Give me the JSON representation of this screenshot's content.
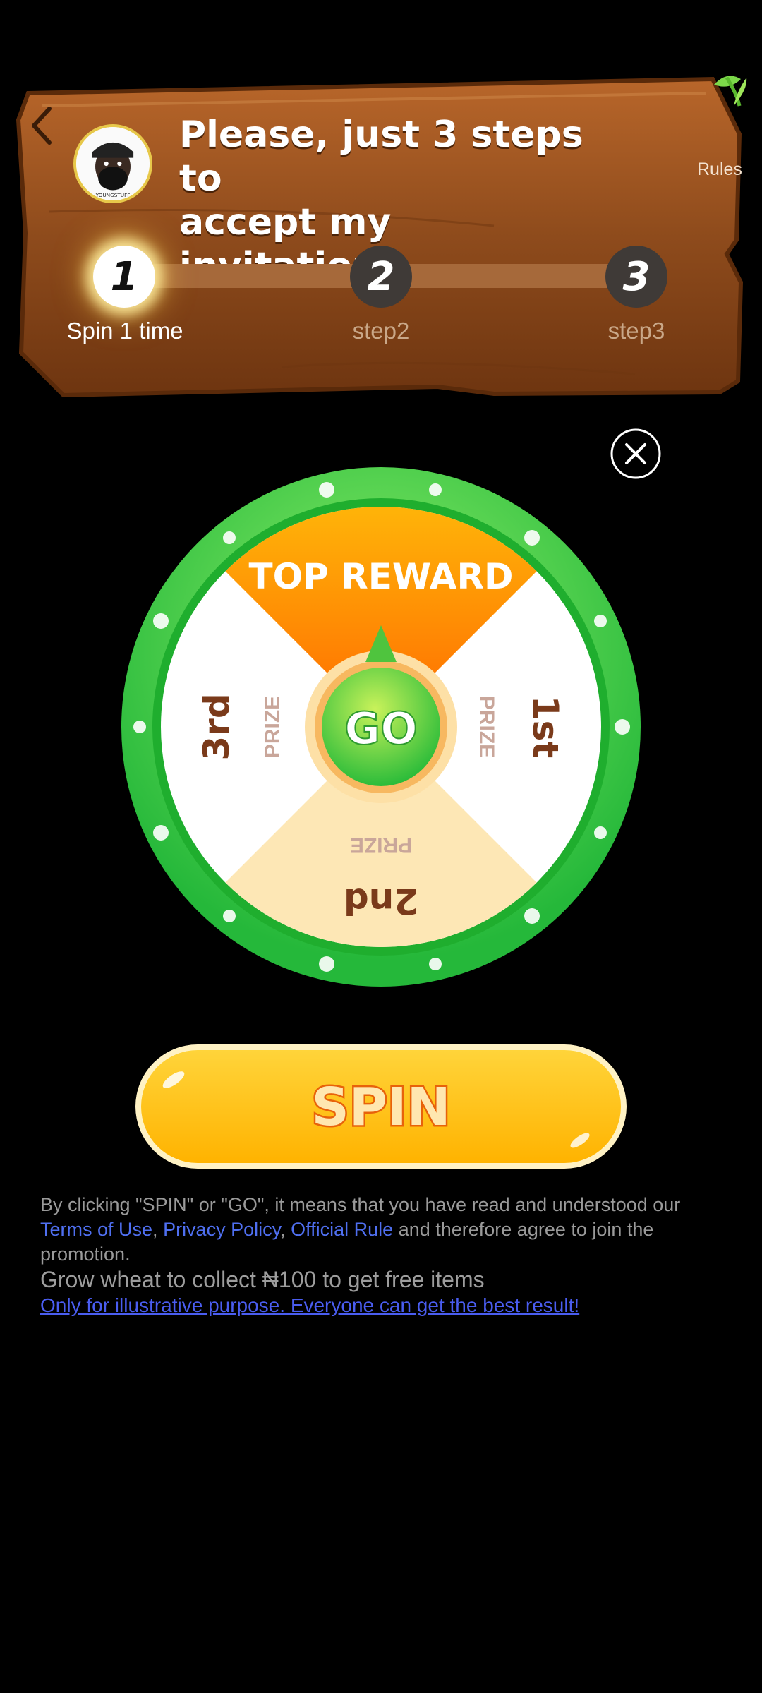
{
  "header": {
    "title_line1": "Please, just 3 steps to",
    "title_line2": "accept my invitation!",
    "rules_label": "Rules",
    "avatar_caption": "YOUNGSTUFF"
  },
  "steps": [
    {
      "number": "1",
      "label": "Spin 1 time",
      "status": "active"
    },
    {
      "number": "2",
      "label": "step2",
      "status": "pending"
    },
    {
      "number": "3",
      "label": "step3",
      "status": "pending"
    }
  ],
  "wheel": {
    "top": "TOP REWARD",
    "right_main": "1st",
    "right_sub": "PRIZE",
    "bottom_main": "2nd",
    "bottom_sub": "PRIZE",
    "left_main": "3rd",
    "left_sub": "PRIZE",
    "center_label": "GO"
  },
  "spin_label": "SPIN",
  "legal": {
    "text_before": "By clicking \"SPIN\" or \"GO\", it means that you have read and understood our ",
    "terms_link": "Terms of Use",
    "sep1": ", ",
    "privacy_link": "Privacy Policy",
    "sep2": ", ",
    "rule_link": "Official Rule",
    "text_after": " and therefore agree to join the promotion.",
    "grow_text": "Grow wheat to collect ₦100 to get free items",
    "illustrative_link": "Only for illustrative purpose. Everyone can get the best result!"
  },
  "colors": {
    "wood": "#8a4a1c",
    "wheel_ring": "#3ccf4a",
    "top_segment": "#ff7a00",
    "bottom_segment": "#fde7b5",
    "spin_button": "#ffc61a",
    "link": "#4f6ff0"
  },
  "icons": [
    "back-chevron-icon",
    "leaf-icon",
    "close-icon",
    "pointer-arrow-icon"
  ]
}
